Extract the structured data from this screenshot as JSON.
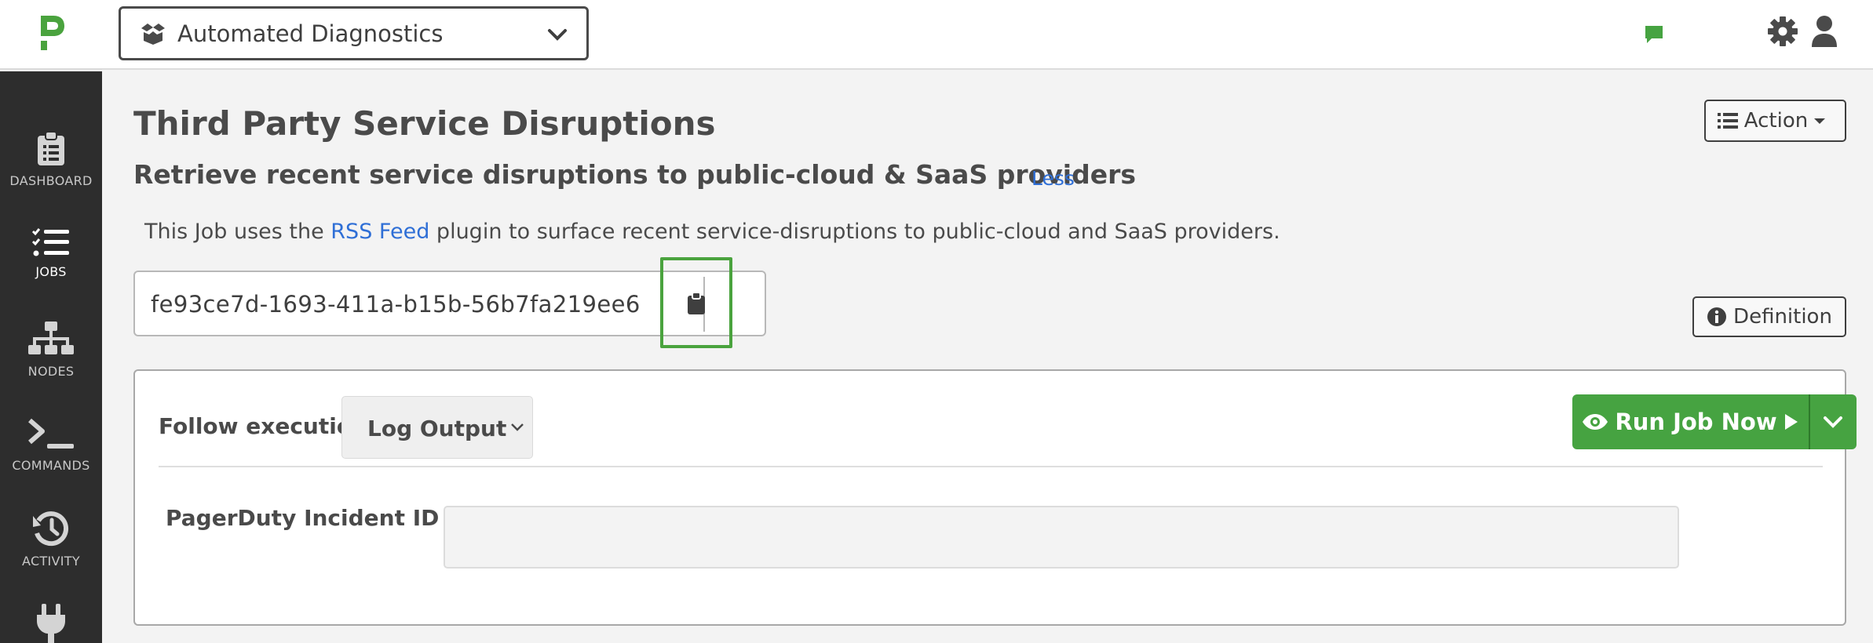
{
  "header": {
    "project": "Automated Diagnostics"
  },
  "sidebar": {
    "items": [
      {
        "label": "DASHBOARD",
        "icon": "clipboard-icon"
      },
      {
        "label": "JOBS",
        "icon": "tasks-icon",
        "active": true
      },
      {
        "label": "NODES",
        "icon": "sitemap-icon"
      },
      {
        "label": "COMMANDS",
        "icon": "terminal-icon"
      },
      {
        "label": "ACTIVITY",
        "icon": "history-icon"
      },
      {
        "label": "",
        "icon": "plug-icon"
      }
    ]
  },
  "job": {
    "title": "Third Party Service Disruptions",
    "action_label": "Action",
    "subtitle": "Retrieve recent service disruptions to public-cloud & SaaS providers",
    "less_label": "Less",
    "description_prefix": "This Job uses the ",
    "description_link": "RSS Feed",
    "description_suffix": " plugin to surface recent service-disruptions to public-cloud and SaaS providers.",
    "uuid": "fe93ce7d-1693-411a-b15b-56b7fa219ee6",
    "definition_label": "Definition"
  },
  "run_panel": {
    "follow_label": "Follow execution",
    "follow_value": "Log Output",
    "run_label": "Run Job Now",
    "option_label": "PagerDuty Incident ID",
    "option_value": ""
  },
  "colors": {
    "accent_green": "#46a341",
    "link_blue": "#2f6fd6",
    "sidebar_bg": "#2d2d2d",
    "highlight": "#4aa33e"
  }
}
